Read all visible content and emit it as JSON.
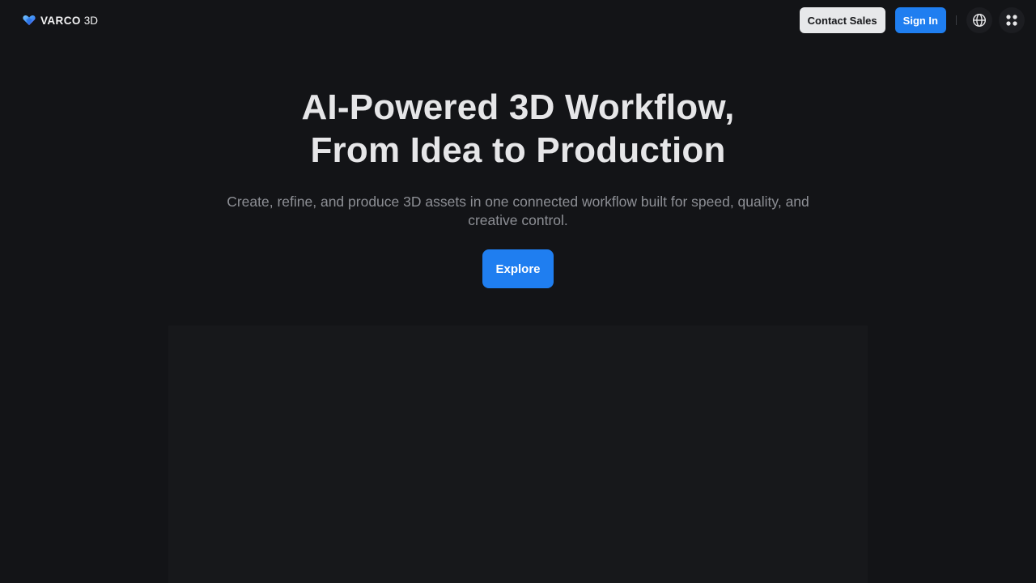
{
  "header": {
    "logo": {
      "word": "VARCO",
      "suffix": "3D",
      "icon": "varco-heart-logo"
    },
    "contact_sales_label": "Contact Sales",
    "sign_in_label": "Sign In",
    "language_icon": "globe-icon",
    "apps_icon": "apps-grid-icon"
  },
  "hero": {
    "title_line1": "AI-Powered 3D Workflow,",
    "title_line2": "From Idea to Production",
    "subtitle": "Create, refine, and produce 3D assets in one connected workflow built for speed, quality, and creative control.",
    "explore_label": "Explore"
  },
  "colors": {
    "background": "#131417",
    "accent": "#1f7ef0",
    "secondary_button": "#e7e8ea"
  }
}
